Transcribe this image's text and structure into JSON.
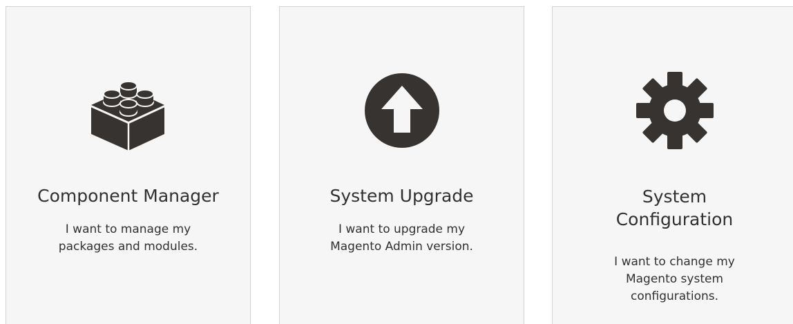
{
  "tiles": [
    {
      "icon": "lego-brick-icon",
      "title": "Component Manager",
      "description": "I want to manage my packages and modules."
    },
    {
      "icon": "upgrade-arrow-icon",
      "title": "System Upgrade",
      "description": "I want to upgrade my Magento Admin version."
    },
    {
      "icon": "gear-icon",
      "title": "System Configuration",
      "description": "I want to change my Magento system configurations."
    }
  ],
  "colors": {
    "tile_background": "#f6f6f6",
    "tile_border": "#d3d3d3",
    "icon": "#373330",
    "text": "#303030"
  }
}
